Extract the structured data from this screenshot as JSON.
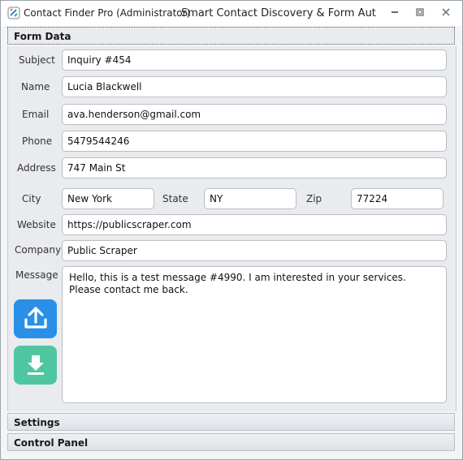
{
  "window": {
    "app_name": "Contact Finder Pro (Administrator)",
    "subtitle": "Smart Contact Discovery & Form Aut..."
  },
  "sections": {
    "form_data": "Form Data",
    "settings": "Settings",
    "control_panel": "Control Panel"
  },
  "labels": {
    "subject": "Subject",
    "name": "Name",
    "email": "Email",
    "phone": "Phone",
    "address": "Address",
    "city": "City",
    "state": "State",
    "zip": "Zip",
    "website": "Website",
    "company": "Company",
    "message": "Message"
  },
  "values": {
    "subject": "Inquiry #454",
    "name": "Lucia Blackwell",
    "email": "ava.henderson@gmail.com",
    "phone": "5479544246",
    "address": "747 Main St",
    "city": "New York",
    "state": "NY",
    "zip": "77224",
    "website": "https://publicscraper.com",
    "company": "Public Scraper",
    "message": "Hello, this is a test message #4990. I am interested in your services. Please contact me back."
  },
  "icons": {
    "app": "app-logo-icon",
    "upload": "upload-icon",
    "download": "download-icon",
    "minimize": "minimize-icon",
    "restore": "restore-icon",
    "close": "close-icon"
  },
  "colors": {
    "upload_button": "#2a8fe6",
    "download_button": "#4fc6a0"
  }
}
